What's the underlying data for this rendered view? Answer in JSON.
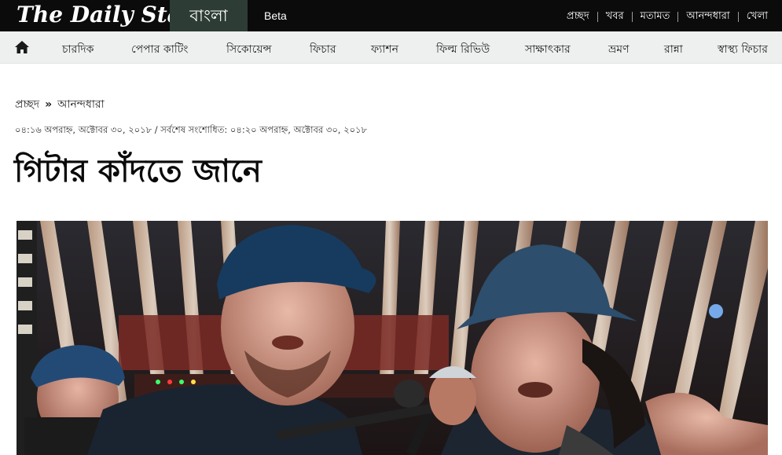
{
  "header": {
    "logo_text": "The Daily Star",
    "language_tab": "বাংলা",
    "beta_label": "Beta",
    "top_nav": [
      "প্রচ্ছদ",
      "খবর",
      "মতামত",
      "আনন্দধারা",
      "খেলা"
    ]
  },
  "category_nav": {
    "home_icon": "home-icon",
    "items": [
      "চারদিক",
      "পেপার কাটিং",
      "সিকোয়েন্স",
      "ফিচার",
      "ফ্যাশন",
      "ফিল্ম রিভিউ",
      "সাক্ষাৎকার",
      "ভ্রমণ",
      "রান্না",
      "স্বাস্থ্য ফিচার"
    ]
  },
  "breadcrumb": {
    "home": "প্রচ্ছদ",
    "separator": "»",
    "section": "আনন্দধারা"
  },
  "article": {
    "timestamp": "০৪:১৬ অপরাহ্ন, অক্টোবর ৩০, ২০১৮ / সর্বশেষ সংশোধিত: ০৪:২০ অপরাহ্ন, অক্টোবর ৩০, ২০১৮",
    "headline": "গিটার কাঁদতে জানে"
  },
  "colors": {
    "topbar_bg": "#0b0b0b",
    "bangla_tab_bg": "#2d3c35",
    "catbar_bg": "#eef0f0"
  }
}
